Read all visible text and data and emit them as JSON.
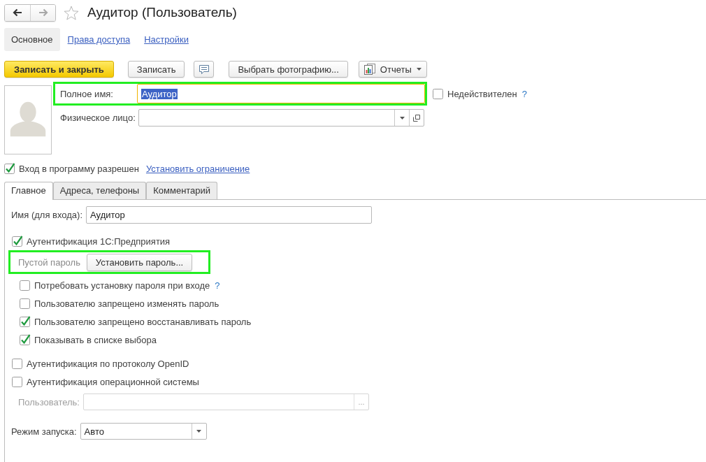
{
  "nav": [
    {
      "kind": "back",
      "disabled": false
    },
    {
      "kind": "forward",
      "disabled": true
    }
  ],
  "favorite": false,
  "title": "Аудитор (Пользователь)",
  "sections": [
    {
      "label": "Основное",
      "selected": true
    },
    {
      "label": "Права доступа",
      "selected": false
    },
    {
      "label": "Настройки",
      "selected": false
    }
  ],
  "toolbar": [
    {
      "kind": "primary",
      "label": "Записать и закрыть"
    },
    {
      "kind": "button",
      "label": "Записать"
    },
    {
      "kind": "icon"
    },
    {
      "kind": "button",
      "label": "Выбрать фотографию..."
    },
    {
      "kind": "menu",
      "label": "Отчеты"
    }
  ],
  "full_name": {
    "label": "Полное имя:",
    "value": "Аудитор",
    "focused": true,
    "text_selected": true,
    "highlighted": true
  },
  "invalid": {
    "label": "Недействителен",
    "checked": false,
    "help": "?"
  },
  "person": {
    "label": "Физическое лицо:"
  },
  "login_allowed": {
    "label": "Вход в программу разрешен",
    "checked": true,
    "link": "Установить ограничение"
  },
  "tabs": [
    {
      "label": "Главное",
      "selected": true
    },
    {
      "label": "Адреса, телефоны",
      "selected": false
    },
    {
      "label": "Комментарий",
      "selected": false
    }
  ],
  "login_name": {
    "label": "Имя (для входа):",
    "value": "Аудитор"
  },
  "auth_1c": {
    "label": "Аутентификация 1С:Предприятия",
    "checked": true
  },
  "password": {
    "status": "Пустой пароль",
    "button": "Установить пароль...",
    "highlighted": true
  },
  "password_options": [
    {
      "label": "Потребовать установку пароля при входе",
      "checked": false,
      "help": "?"
    },
    {
      "label": "Пользователю запрещено изменять пароль",
      "checked": false
    },
    {
      "label": "Пользователю запрещено восстанавливать пароль",
      "checked": true
    },
    {
      "label": "Показывать в списке выбора",
      "checked": true
    }
  ],
  "other_auth": [
    {
      "label": "Аутентификация по протоколу OpenID",
      "checked": false
    },
    {
      "label": "Аутентификация операционной системы",
      "checked": false
    }
  ],
  "os_user": {
    "label": "Пользователь:",
    "disabled": true,
    "button": "..."
  },
  "launch_mode": {
    "label": "Режим запуска:",
    "value": "Авто"
  }
}
